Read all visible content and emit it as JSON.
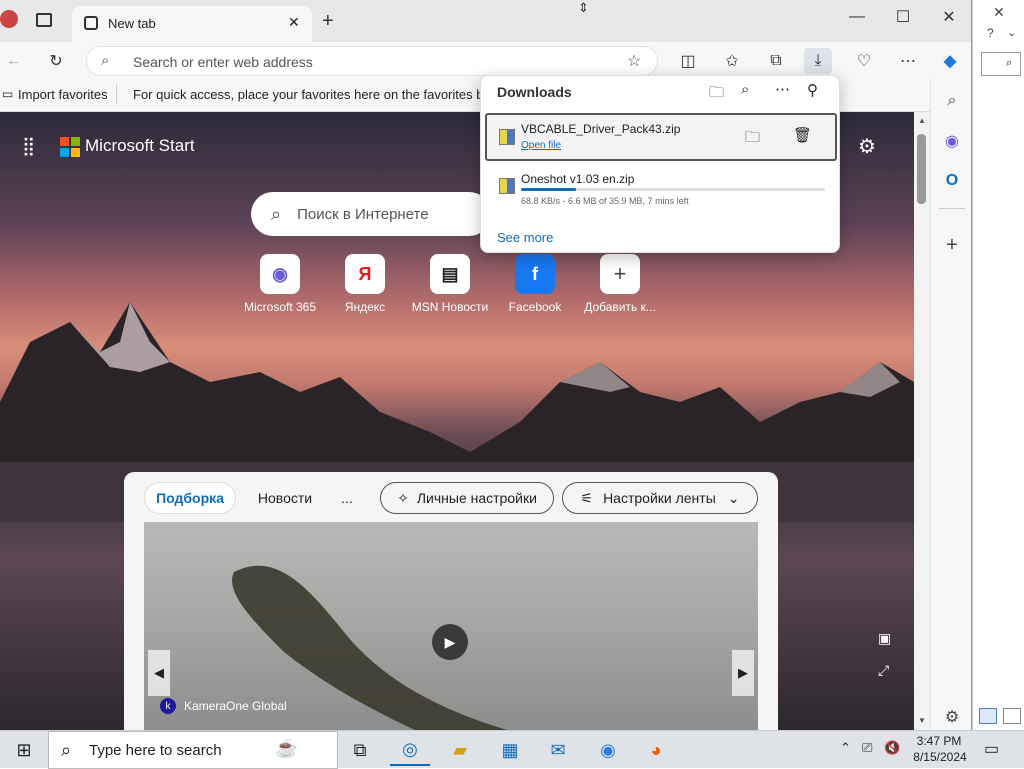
{
  "browser": {
    "tab_title": "New tab",
    "address_placeholder": "Search or enter web address"
  },
  "favorites_bar": {
    "import_label": "Import favorites",
    "hint": "For quick access, place your favorites here on the favorites bar."
  },
  "page": {
    "brand": "Microsoft Start",
    "search_placeholder": "Поиск в Интернете",
    "quick_links": [
      {
        "label": "Microsoft 365",
        "icon": "m365-icon"
      },
      {
        "label": "Яндекс",
        "icon": "yandex-icon"
      },
      {
        "label": "MSN Новости",
        "icon": "msn-news-icon"
      },
      {
        "label": "Facebook",
        "icon": "facebook-icon"
      },
      {
        "label": "Добавить к...",
        "icon": "add-icon"
      }
    ],
    "feed_tabs": {
      "active": "Подборка",
      "news": "Новости",
      "more": "...",
      "personalize": "Личные настройки",
      "feed_settings": "Настройки ленты"
    },
    "video_source": "KameraOne Global"
  },
  "downloads": {
    "title": "Downloads",
    "items": [
      {
        "file": "VBCABLE_Driver_Pack43.zip",
        "action": "Open file"
      },
      {
        "file": "Oneshot v1.03 en.zip",
        "status": "68.8 KB/s - 6.6 MB of 35.9 MB, 7 mins left",
        "progress": 0.18
      }
    ],
    "see_more": "See more"
  },
  "taskbar": {
    "search_placeholder": "Type here to search",
    "time": "3:47 PM",
    "date": "8/15/2024"
  },
  "colors": {
    "accent": "#0f6cbd",
    "facebook": "#1877f2"
  }
}
